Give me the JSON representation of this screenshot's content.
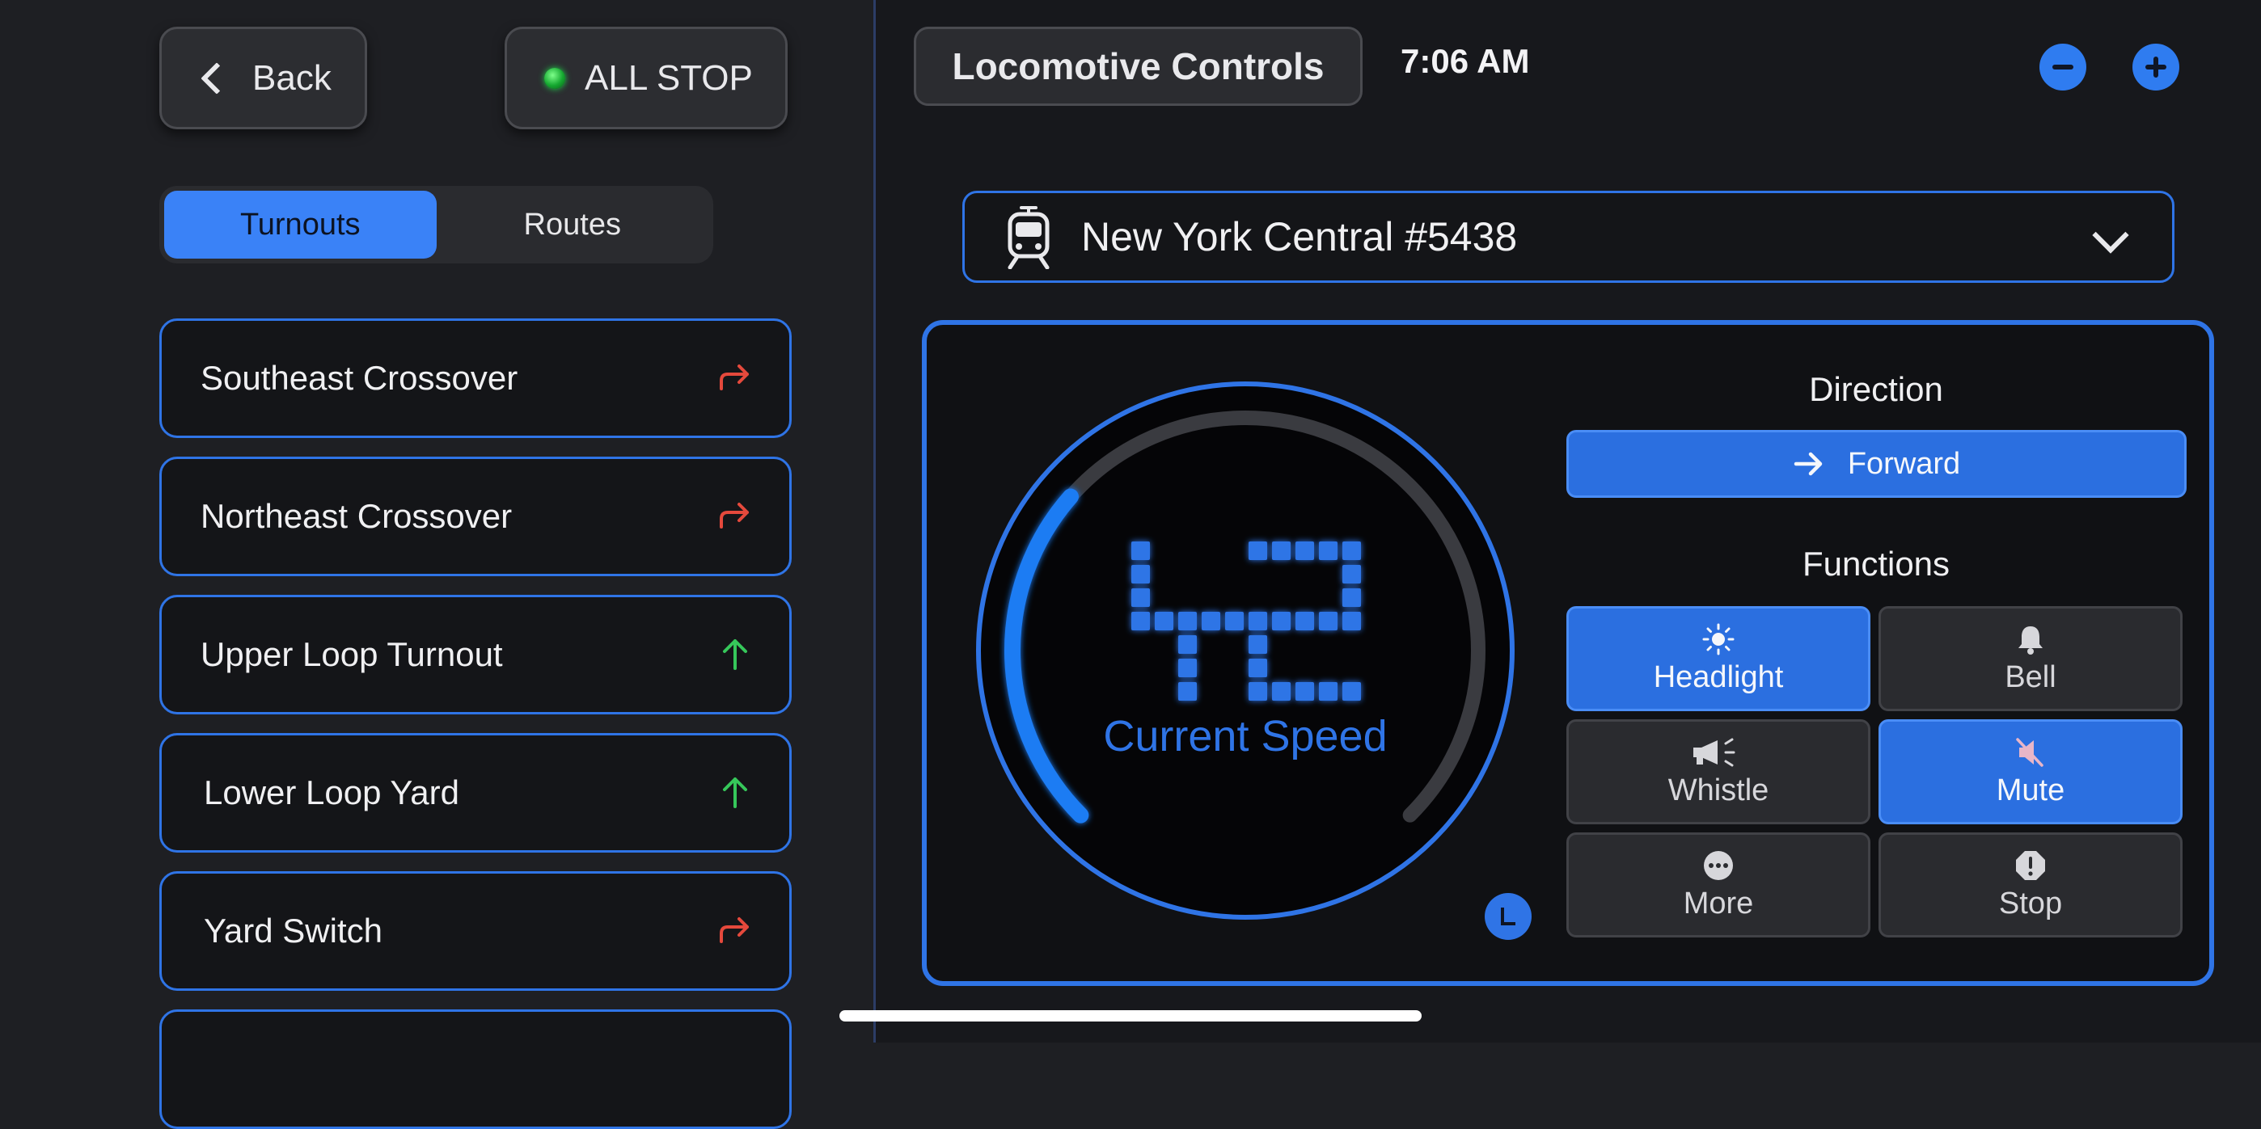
{
  "left_panel": {
    "back_label": "Back",
    "all_stop_label": "ALL STOP",
    "tabs": [
      {
        "label": "Turnouts",
        "active": true
      },
      {
        "label": "Routes",
        "active": false
      }
    ],
    "turnouts": [
      {
        "name": "Southeast Crossover",
        "state": "diverging",
        "icon": "turn-right-arrow-icon",
        "color": "#e5493c"
      },
      {
        "name": "Northeast Crossover",
        "state": "diverging",
        "icon": "turn-right-arrow-icon",
        "color": "#e5493c"
      },
      {
        "name": "Upper Loop Turnout",
        "state": "straight",
        "icon": "up-arrow-icon",
        "color": "#36c75a"
      },
      {
        "name": "Lower Loop Yard",
        "state": "straight",
        "icon": "up-arrow-icon",
        "color": "#36c75a"
      },
      {
        "name": "Yard Switch",
        "state": "diverging",
        "icon": "turn-right-arrow-icon",
        "color": "#e5493c"
      }
    ]
  },
  "header": {
    "title": "Locomotive Controls",
    "time": "7:06 AM"
  },
  "locomotive": {
    "selected": "New York Central #5438",
    "icon": "tram-icon"
  },
  "throttle": {
    "speed": "42",
    "speed_label": "Current Speed",
    "speed_fraction": 0.32,
    "accent": "#2f74e6"
  },
  "direction": {
    "label": "Direction",
    "value": "Forward"
  },
  "functions": {
    "label": "Functions",
    "items": [
      {
        "label": "Headlight",
        "icon": "sun-icon",
        "on": true
      },
      {
        "label": "Bell",
        "icon": "bell-icon",
        "on": false
      },
      {
        "label": "Whistle",
        "icon": "megaphone-icon",
        "on": false
      },
      {
        "label": "Mute",
        "icon": "speaker-muted-icon",
        "on": true
      },
      {
        "label": "More",
        "icon": "ellipsis-circle-icon",
        "on": false
      },
      {
        "label": "Stop",
        "icon": "exclamation-octagon-icon",
        "on": false
      }
    ]
  }
}
